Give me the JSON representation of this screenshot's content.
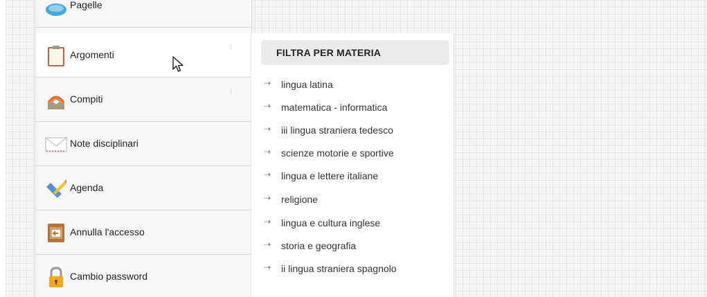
{
  "menu": {
    "items": [
      {
        "label": "Pagelle",
        "icon": "report-card-icon",
        "has_submenu": true
      },
      {
        "label": "Argomenti",
        "icon": "clipboard-icon",
        "has_submenu": true,
        "active": true
      },
      {
        "label": "Compiti",
        "icon": "homework-icon",
        "has_submenu": true
      },
      {
        "label": "Note disciplinari",
        "icon": "envelope-icon",
        "has_submenu": false
      },
      {
        "label": "Agenda",
        "icon": "pencil-ruler-icon",
        "has_submenu": false
      },
      {
        "label": "Annulla l'accesso",
        "icon": "logout-icon",
        "has_submenu": false
      },
      {
        "label": "Cambio password",
        "icon": "lock-icon",
        "has_submenu": false
      }
    ]
  },
  "submenu": {
    "title": "FILTRA PER MATERIA",
    "bullet": "⇢",
    "subjects": [
      "lingua latina",
      "matematica - informatica",
      "iii lingua straniera tedesco",
      "scienze motorie e sportive",
      "lingua e lettere italiane",
      "religione",
      "lingua e cultura inglese",
      "storia e geografia",
      "ii lingua straniera spagnolo"
    ]
  },
  "colors": {
    "menu_background": "#f7f7f7",
    "active_background": "#ffffff",
    "header_background": "#ebebeb",
    "grid_line": "#e6e6e6"
  }
}
